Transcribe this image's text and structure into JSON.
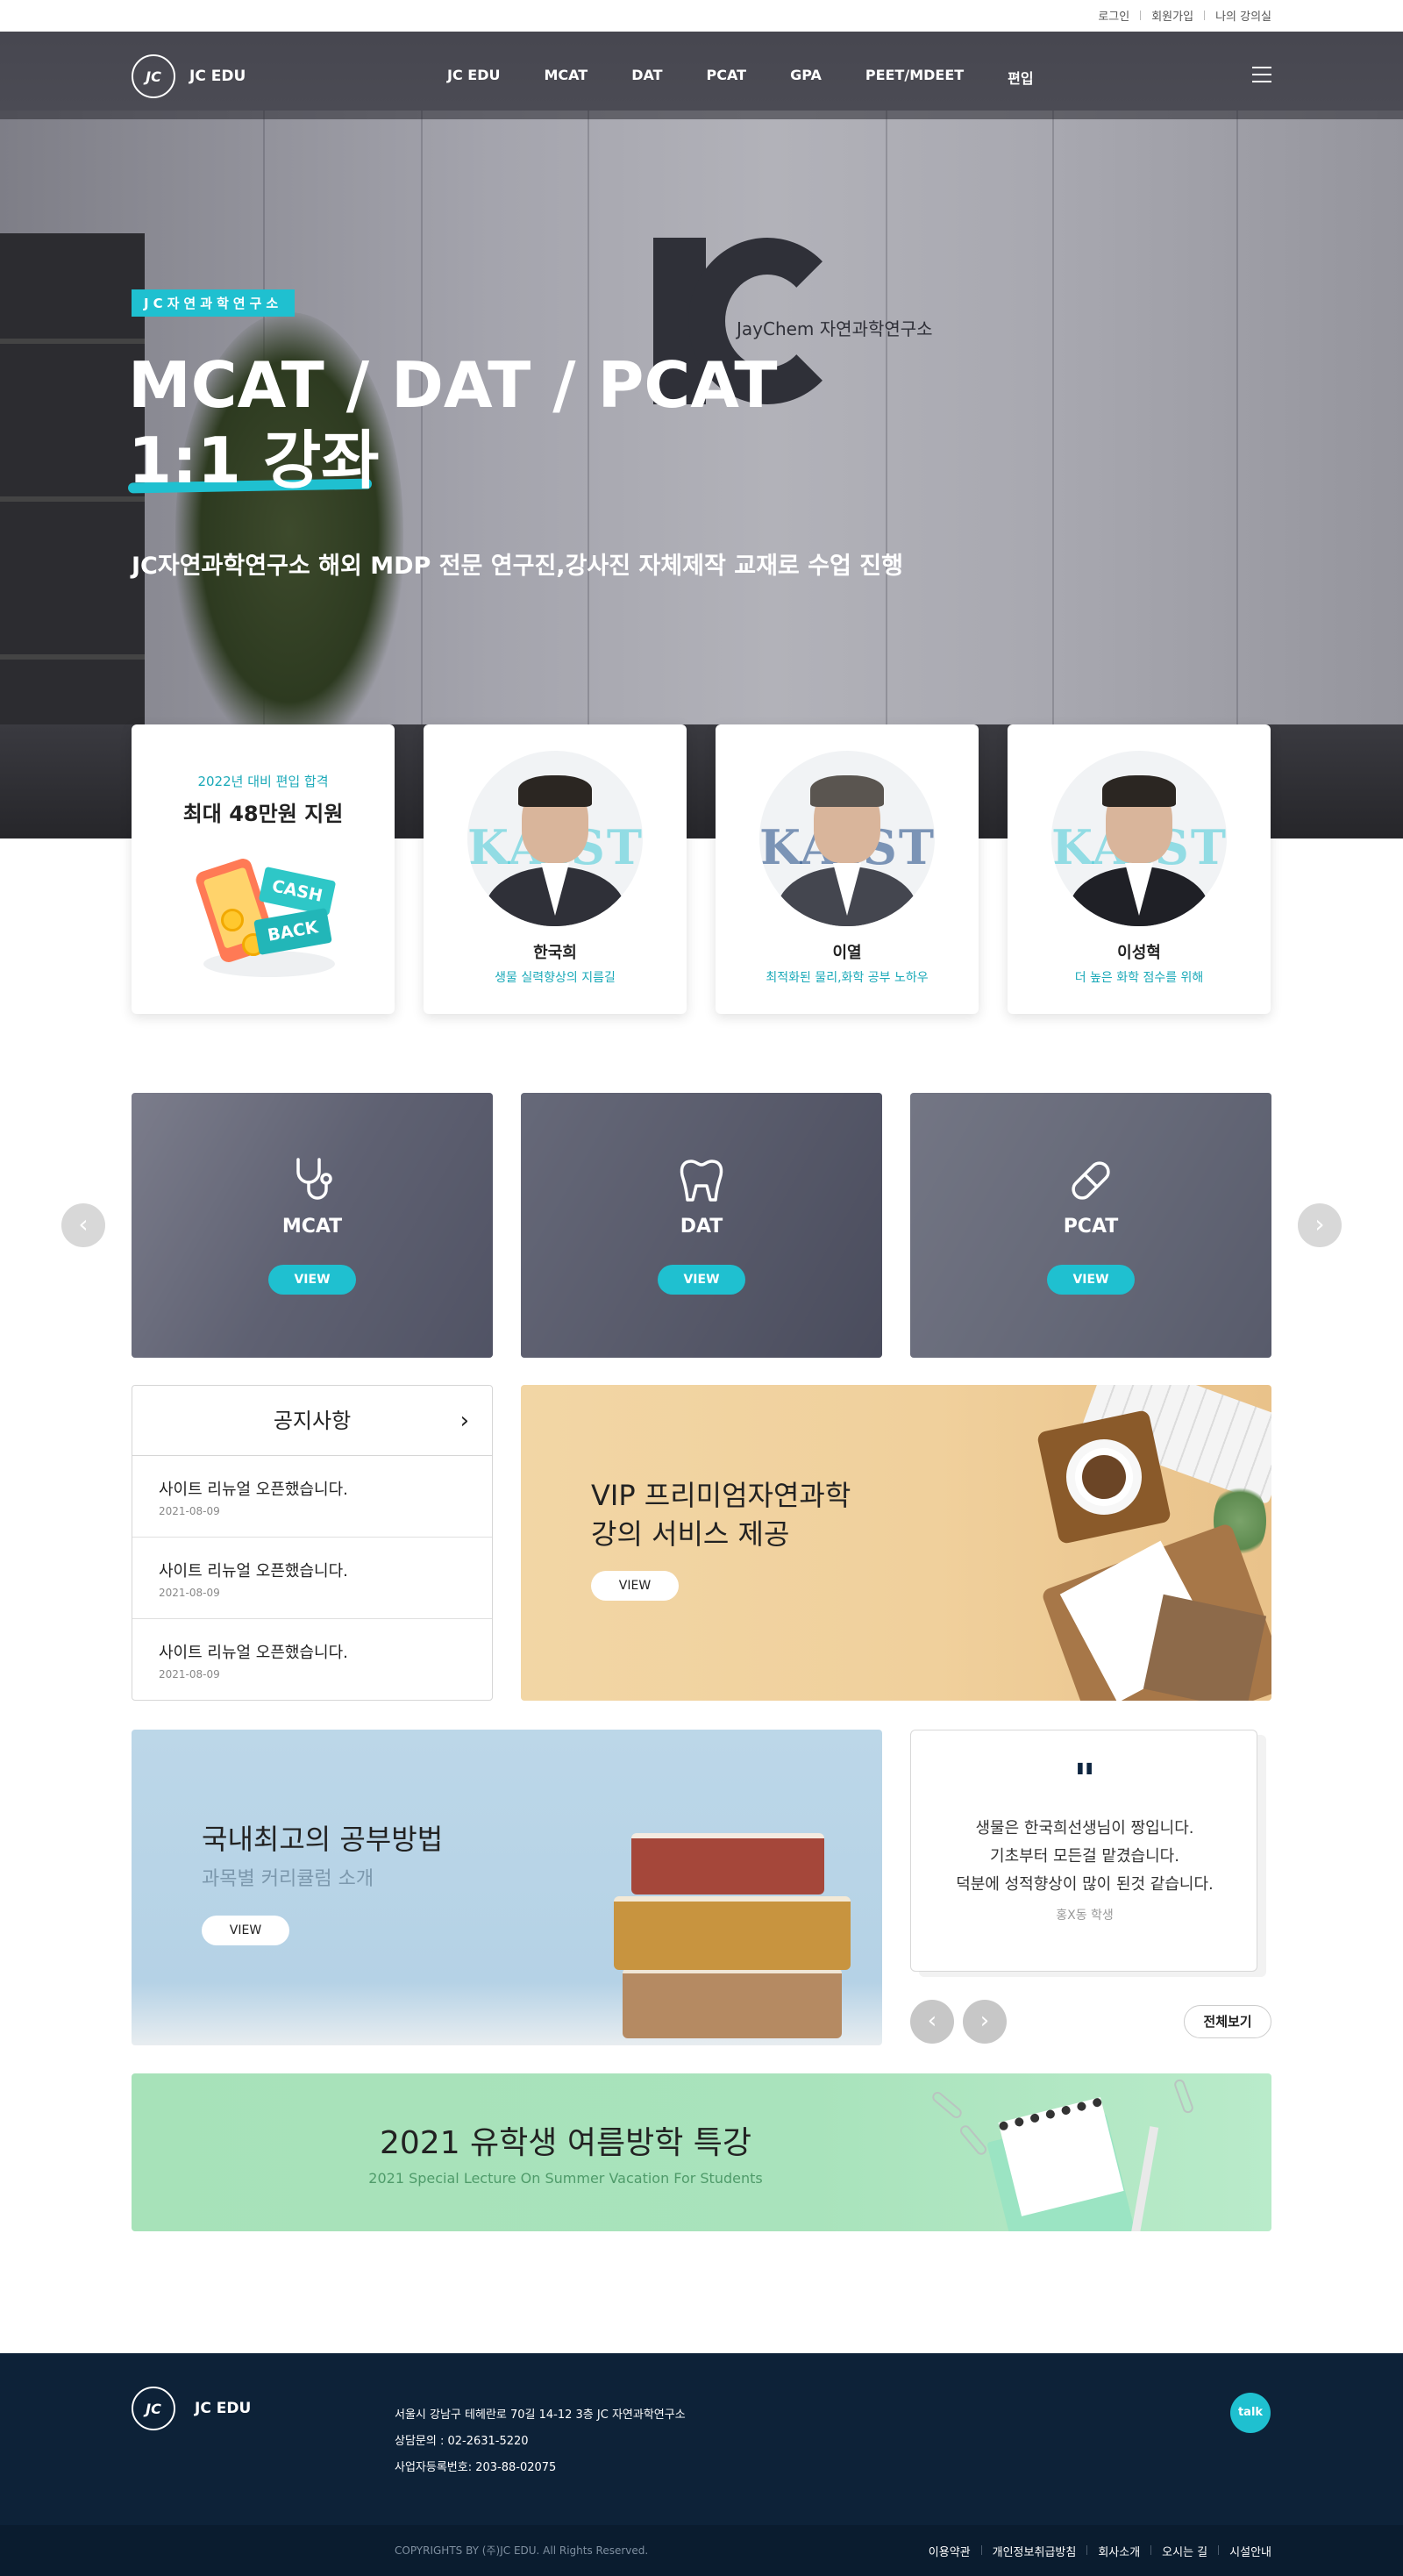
{
  "util_bar": {
    "links": [
      "로그인",
      "회원가입",
      "나의 강의실"
    ]
  },
  "nav": {
    "brand": "JC EDU",
    "logo_text": "JC",
    "items": [
      "JC EDU",
      "MCAT",
      "DAT",
      "PCAT",
      "GPA",
      "PEET/MDEET",
      "편입"
    ],
    "menu_icon": "hamburger-icon"
  },
  "hero": {
    "badge": "JC자연과학연구소",
    "title": "MCAT / DAT / PCAT",
    "subtitle": "1:1 강좌",
    "description": "JC자연과학연구소 해외 MDP 전문 연구진,강사진 자체제작 교재로 수업 진행",
    "wall_logo_text": "JayChem 자연과학연구소"
  },
  "promo_card": {
    "top": "2022년 대비 편입 합격",
    "main": "최대 48만원 지원",
    "tag1": "CASH",
    "tag2": "BACK"
  },
  "teachers": [
    {
      "name": "한국희",
      "desc": "생물 실력향상의 지름길",
      "bg_text": "KAIST"
    },
    {
      "name": "이열",
      "desc": "최적화된 물리,화학 공부 노하우",
      "bg_text": "KAIST"
    },
    {
      "name": "이성혁",
      "desc": "더 높은 화학 점수를 위해",
      "bg_text": "KAIST"
    }
  ],
  "categories": [
    {
      "label": "MCAT",
      "button": "VIEW",
      "icon": "stethoscope-icon"
    },
    {
      "label": "DAT",
      "button": "VIEW",
      "icon": "tooth-icon"
    },
    {
      "label": "PCAT",
      "button": "VIEW",
      "icon": "pill-icon"
    }
  ],
  "notice": {
    "title": "공지사항",
    "items": [
      {
        "title": "사이트 리뉴얼 오픈했습니다.",
        "date": "2021-08-09"
      },
      {
        "title": "사이트 리뉴얼 오픈했습니다.",
        "date": "2021-08-09"
      },
      {
        "title": "사이트 리뉴얼 오픈했습니다.",
        "date": "2021-08-09"
      }
    ]
  },
  "vip_banner": {
    "line1": "VIP 프리미엄자연과학",
    "line2": "강의 서비스 제공",
    "button": "VIEW"
  },
  "study_banner": {
    "title": "국내최고의 공부방법",
    "subtitle": "과목별 커리큘럼 소개",
    "button": "VIEW"
  },
  "testimonial": {
    "quote_mark": "\"",
    "lines": [
      "생물은 한국희선생님이 짱입니다.",
      "기초부터 모든걸 맡겼습니다.",
      "덕분에 성적향상이 많이 된것 같습니다."
    ],
    "author": "홍X동 학생",
    "all_button": "전체보기"
  },
  "summer_banner": {
    "title": "2021 유학생 여름방학 특강",
    "subtitle": "2021 Special Lecture On Summer Vacation For Students"
  },
  "footer": {
    "brand": "JC EDU",
    "logo_text": "JC",
    "address": "서울시 강남구 테헤란로 70길 14-12 3층 JC 자연과학연구소",
    "phone": "상담문의 :  02-2631-5220",
    "biz_no": "사업자등록번호: 203-88-02075",
    "chat_label": "talk",
    "copyright": "COPYRIGHTS BY (주)JC EDU. All Rights Reserved.",
    "links": [
      "이용약관",
      "개인정보취급방침",
      "회사소개",
      "오시는 길",
      "시설안내"
    ]
  },
  "colors": {
    "accent": "#1fc0d0",
    "footer_bg": "#0d2238",
    "footer_bar": "#0a1c2f"
  }
}
